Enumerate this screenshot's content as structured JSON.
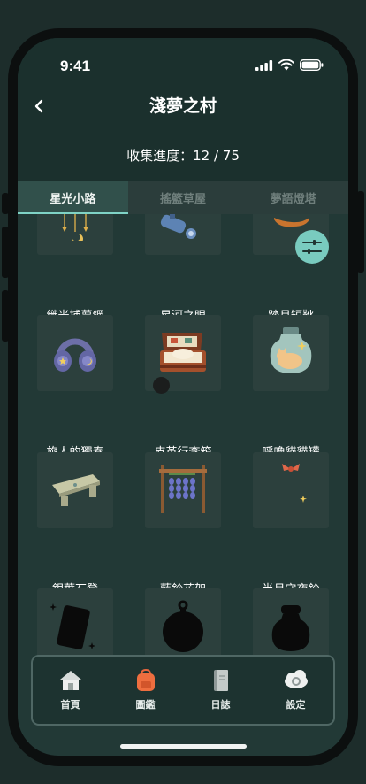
{
  "status_bar": {
    "time": "9:41"
  },
  "header": {
    "title": "淺夢之村",
    "progress_label": "收集進度：",
    "progress_collected": 12,
    "progress_total": 75,
    "progress_text": "收集進度：12 / 75"
  },
  "tabs": [
    {
      "label": "星光小路",
      "active": true
    },
    {
      "label": "搖籃草屋",
      "active": false
    },
    {
      "label": "夢語燈塔",
      "active": false
    }
  ],
  "collection": {
    "items": [
      {
        "name": "織光捕夢網",
        "icon": "dreamcatcher-icon",
        "collected": true
      },
      {
        "name": "星河之眼",
        "icon": "telescope-icon",
        "collected": true
      },
      {
        "name": "踏月短靴",
        "icon": "boot-icon",
        "collected": true
      },
      {
        "name": "旅人的獨奏",
        "icon": "headphones-icon",
        "collected": true
      },
      {
        "name": "皮革行李箱",
        "icon": "suitcase-icon",
        "collected": true
      },
      {
        "name": "呼嚕貓貓罐",
        "icon": "cat-jar-icon",
        "collected": true
      },
      {
        "name": "銀葉石凳",
        "icon": "stone-bench-icon",
        "collected": true
      },
      {
        "name": "藍鈴花架",
        "icon": "bluebell-rack-icon",
        "collected": true
      },
      {
        "name": "半月守夜鈴",
        "icon": "moon-bell-icon",
        "collected": true
      },
      {
        "name": "",
        "icon": "locked-tablet-silhouette",
        "collected": false
      },
      {
        "name": "",
        "icon": "locked-pocket-watch-silhouette",
        "collected": false
      },
      {
        "name": "",
        "icon": "locked-jar-silhouette",
        "collected": false
      }
    ]
  },
  "nav": [
    {
      "label": "首頁",
      "icon": "house-icon"
    },
    {
      "label": "圖鑑",
      "icon": "backpack-icon"
    },
    {
      "label": "日誌",
      "icon": "journal-icon"
    },
    {
      "label": "設定",
      "icon": "cloud-gear-icon"
    }
  ],
  "colors": {
    "background": "#223936",
    "accent": "#79cbbf",
    "tab_indicator": "#7fd3c6",
    "card": "#2c403d"
  }
}
